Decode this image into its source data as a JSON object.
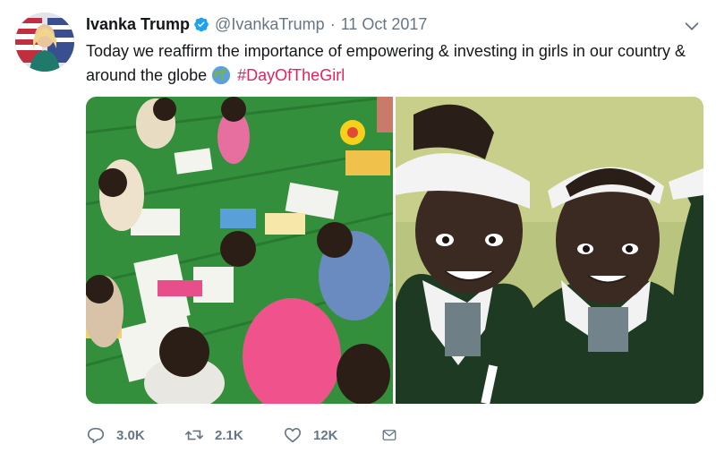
{
  "tweet": {
    "author_name": "Ivanka Trump",
    "handle": "@IvankaTrump",
    "separator": "·",
    "date": "11 Oct 2017",
    "text_main": "Today we reaffirm the importance of empowering & investing in girls in our country & around the globe",
    "hashtag": "#DayOfTheGirl"
  },
  "actions": {
    "reply_count": "3.0K",
    "retweet_count": "2.1K",
    "like_count": "12K"
  },
  "icons": {
    "verified": "verified-badge-icon",
    "caret": "chevron-down-icon",
    "globe": "globe-emoji-icon",
    "reply": "reply-icon",
    "retweet": "retweet-icon",
    "like": "heart-icon",
    "message": "envelope-icon"
  },
  "colors": {
    "text": "#14171a",
    "muted": "#657786",
    "hashtag": "#e0245e",
    "verified": "#1da1f2"
  }
}
